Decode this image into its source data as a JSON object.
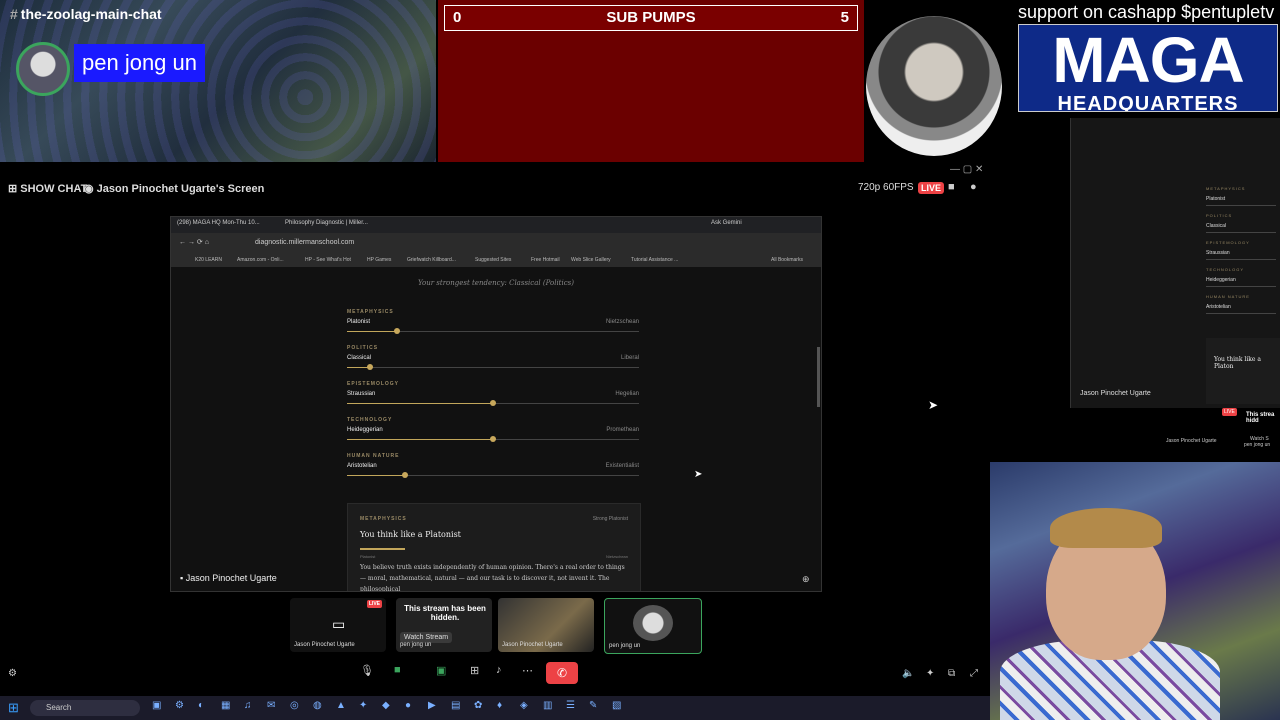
{
  "top": {
    "channel": "the-zoolag-main-chat",
    "speaker_name": "pen jong un",
    "pump_left": "0",
    "pump_title": "SUB PUMPS",
    "pump_right": "5",
    "cashapp_text": "support on cashapp $pentupletv",
    "logo_big": "MAGA",
    "logo_small": "HEADQUARTERS"
  },
  "stream": {
    "show_chat": "SHOW CHAT",
    "title": "Jason Pinochet Ugarte's Screen",
    "resolution": "720p 60FPS",
    "live": "LIVE",
    "name_tag": "Jason Pinochet Ugarte"
  },
  "browser": {
    "tabs": [
      "(298) MAGA HQ Mon-Thu 10...",
      "Philosophy Diagnostic | Miller..."
    ],
    "ask": "Ask Gemini",
    "url": "diagnostic.millermanschool.com",
    "bookmarks": [
      "K20 LEARN",
      "Amazon.com - Onli...",
      "HP - See What's Hot",
      "HP Games",
      "Griefwatch Killboard...",
      "Suggested Sites",
      "Free Hotmail",
      "Web Slice Gallery",
      "Tutorial Assistance ...",
      "All Bookmarks"
    ],
    "tendency": "Your strongest tendency: Classical (Politics)",
    "sliders": [
      {
        "category": "METAPHYSICS",
        "left": "Platonist",
        "right": "Nietzschean",
        "value": 0.17
      },
      {
        "category": "POLITICS",
        "left": "Classical",
        "right": "Liberal",
        "value": 0.08
      },
      {
        "category": "EPISTEMOLOGY",
        "left": "Straussian",
        "right": "Hegelian",
        "value": 0.5
      },
      {
        "category": "TECHNOLOGY",
        "left": "Heideggerian",
        "right": "Promethean",
        "value": 0.5
      },
      {
        "category": "HUMAN NATURE",
        "left": "Aristotelian",
        "right": "Existentialist",
        "value": 0.2
      }
    ],
    "result": {
      "category": "METAPHYSICS",
      "strength": "Strong Platonist",
      "title": "You think like a Platonist",
      "end_left": "Platonist",
      "end_right": "Nietzschean",
      "text": "You believe truth exists independently of human opinion. There's a real order to things — moral, mathematical, natural — and our task is to discover it, not invent it. The philosophical"
    }
  },
  "tiles": [
    {
      "name": "Jason Pinochet Ugarte",
      "live": "LIVE"
    },
    {
      "message": "This stream has been hidden.",
      "button": "Watch Stream",
      "name": "pen jong un"
    },
    {
      "name": "Jason Pinochet Ugarte"
    },
    {
      "name": "pen jong un"
    }
  ],
  "mini": {
    "name_tag": "Jason Pinochet Ugarte",
    "card_title": "You think like a Platon",
    "tile_live": "LIVE",
    "tile_name": "Jason Pinochet Ugarte",
    "tile2_text": "This strea hidd",
    "tile2_btn": "Watch S",
    "tile2_name": "pen jong un",
    "rows": [
      {
        "category": "METAPHYSICS",
        "label": "Platonist"
      },
      {
        "category": "POLITICS",
        "label": "Classical"
      },
      {
        "category": "EPISTEMOLOGY",
        "label": "Straussian"
      },
      {
        "category": "TECHNOLOGY",
        "label": "Heideggerian"
      },
      {
        "category": "HUMAN NATURE",
        "label": "Aristotelian"
      }
    ]
  },
  "taskbar": {
    "search": "Search"
  }
}
